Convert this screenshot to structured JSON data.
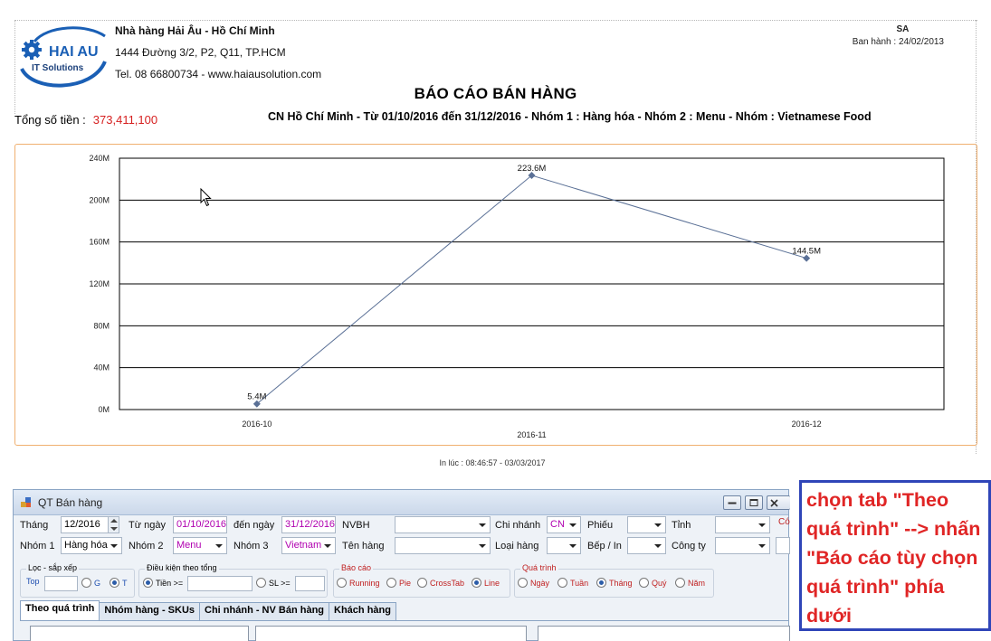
{
  "report": {
    "company_name": "Nhà hàng Hải Âu - Hồ Chí Minh",
    "address": "1444 Đường 3/2, P2, Q11, TP.HCM",
    "contact": "Tel. 08 66800734 - www.haiausolution.com",
    "logo_text": "HAI AU",
    "logo_subtext": "IT Solutions",
    "code": "SA",
    "issued": "Ban hành : 24/02/2013",
    "title": "BÁO CÁO BÁN HÀNG",
    "total_label": "Tổng số tiền :",
    "total_value": "373,411,100",
    "subtitle": "CN Hồ Chí Minh - Từ 01/10/2016 đến 31/12/2016 - Nhóm 1 : Hàng hóa - Nhóm 2 : Menu - Nhóm : Vietnamese Food",
    "printed_at": "In lúc : 08:46:57 - 03/03/2017",
    "colors": {
      "total": "#d62020",
      "chart_frame": "#f0b070",
      "series": "#5a7096"
    }
  },
  "chart_data": {
    "type": "line",
    "categories": [
      "2016-10",
      "2016-11",
      "2016-12"
    ],
    "series": [
      {
        "values": [
          5.4,
          223.6,
          144.5
        ],
        "labels": [
          "5.4M",
          "223.6M",
          "144.5M"
        ]
      }
    ],
    "y_ticks": [
      "0M",
      "40M",
      "80M",
      "120M",
      "160M",
      "200M",
      "240M"
    ],
    "ylim": [
      0,
      240
    ],
    "unit": "M",
    "grid": true
  },
  "window": {
    "title": "QT Bán hàng",
    "fields": {
      "thang_label": "Tháng",
      "thang_value": "12/2016",
      "tungay_label": "Từ ngày",
      "tungay_value": "01/10/2016",
      "denngay_label": "đến ngày",
      "denngay_value": "31/12/2016",
      "nvbh_label": "NVBH",
      "nvbh_value": "",
      "chinhanh_label": "Chi nhánh",
      "chinhanh_value": "CN",
      "phieu_label": "Phiếu",
      "phieu_value": "",
      "tinh_label": "Tỉnh",
      "tinh_value": "",
      "co_label": "Có",
      "nhom1_label": "Nhóm 1",
      "nhom1_value": "Hàng hóa",
      "nhom2_label": "Nhóm 2",
      "nhom2_value": "Menu",
      "nhom3_label": "Nhóm 3",
      "nhom3_value": "Vietnam",
      "tenhang_label": "Tên hàng",
      "tenhang_value": "",
      "loaihang_label": "Loại hàng",
      "loaihang_value": "",
      "bep_label": "Bếp / In",
      "bep_value": "",
      "congty_label": "Công ty",
      "congty_value": ""
    },
    "filter_group": {
      "label": "Lọc - sắp xếp",
      "top_label": "Top",
      "top_value": "",
      "opt_g": "G",
      "opt_t": "T",
      "selected": "T"
    },
    "condition_group": {
      "label": "Điều kiện theo tổng",
      "tien_label": "Tiền >=",
      "tien_value": "",
      "sl_label": "SL >=",
      "sl_value": "",
      "selected": "Tiền"
    },
    "report_group": {
      "label": "Báo cáo",
      "options": [
        "Running",
        "Pie",
        "CrossTab",
        "Line"
      ],
      "selected": "Line"
    },
    "process_group": {
      "label": "Quá trình",
      "options": [
        "Ngày",
        "Tuần",
        "Tháng",
        "Quý",
        "Năm"
      ],
      "selected": "Tháng"
    },
    "tabs": [
      "Theo quá trình",
      "Nhóm hàng - SKUs",
      "Chi nhánh - NV Bán hàng",
      "Khách hàng"
    ],
    "active_tab": "Theo quá trình"
  },
  "callout": {
    "text": "chọn tab \"Theo quá trình\" --> nhấn \"Báo cáo tùy chọn quá trình\" phía dưới",
    "color": "#e02525",
    "border_color": "#2f45b8"
  }
}
